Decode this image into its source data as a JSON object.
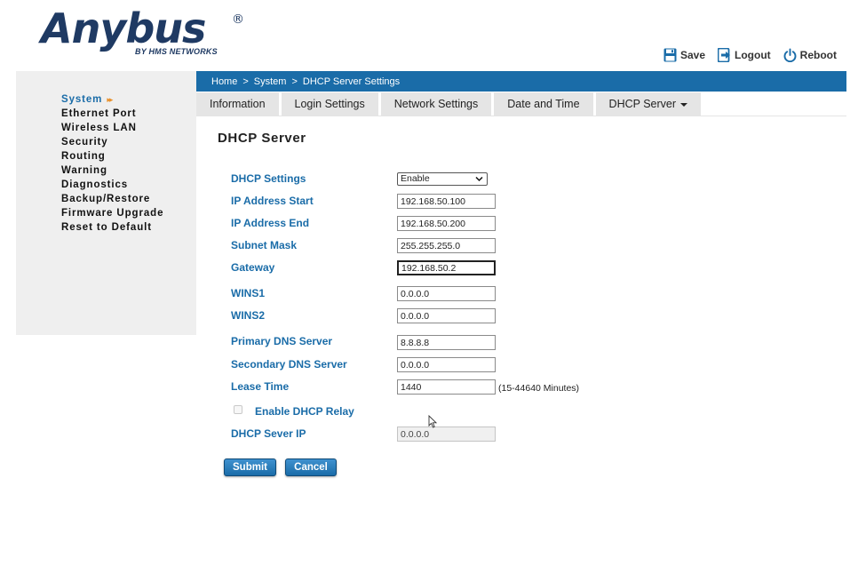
{
  "logo": {
    "name": "Anybus",
    "registered": "®",
    "subtitle": "BY HMS NETWORKS"
  },
  "actions": {
    "save": "Save",
    "logout": "Logout",
    "reboot": "Reboot"
  },
  "sidebar": {
    "items": [
      {
        "label": "System",
        "active": true
      },
      {
        "label": "Ethernet Port"
      },
      {
        "label": "Wireless LAN"
      },
      {
        "label": "Security"
      },
      {
        "label": "Routing"
      },
      {
        "label": "Warning"
      },
      {
        "label": "Diagnostics"
      },
      {
        "label": "Backup/Restore"
      },
      {
        "label": "Firmware Upgrade"
      },
      {
        "label": "Reset to Default"
      }
    ],
    "active_marker": "▸▸"
  },
  "breadcrumb": {
    "home": "Home",
    "sep": ">",
    "system": "System",
    "current": "DHCP Server Settings"
  },
  "tabs": {
    "information": "Information",
    "login_settings": "Login Settings",
    "network_settings": "Network Settings",
    "date_time": "Date and Time",
    "dhcp_server": "DHCP Server"
  },
  "page": {
    "title": "DHCP Server"
  },
  "form": {
    "dhcp_settings": {
      "label": "DHCP Settings",
      "value": "Enable"
    },
    "ip_start": {
      "label": "IP Address Start",
      "value": "192.168.50.100"
    },
    "ip_end": {
      "label": "IP Address End",
      "value": "192.168.50.200"
    },
    "subnet": {
      "label": "Subnet Mask",
      "value": "255.255.255.0"
    },
    "gateway": {
      "label": "Gateway",
      "value": "192.168.50.2"
    },
    "wins1": {
      "label": "WINS1",
      "value": "0.0.0.0"
    },
    "wins2": {
      "label": "WINS2",
      "value": "0.0.0.0"
    },
    "primary_dns": {
      "label": "Primary DNS Server",
      "value": "8.8.8.8"
    },
    "secondary_dns": {
      "label": "Secondary DNS Server",
      "value": "0.0.0.0"
    },
    "lease_time": {
      "label": "Lease Time",
      "value": "1440",
      "hint": "(15-44640 Minutes)"
    },
    "relay": {
      "label": "Enable DHCP Relay",
      "checked": false
    },
    "server_ip": {
      "label": "DHCP Sever IP",
      "value": "0.0.0.0"
    }
  },
  "buttons": {
    "submit": "Submit",
    "cancel": "Cancel"
  },
  "colors": {
    "accent": "#1a6ca8",
    "brand": "#1f3a63",
    "marker": "#e8912d",
    "sidebar_bg": "#efefef",
    "tab_bg": "#e5e5e5"
  }
}
